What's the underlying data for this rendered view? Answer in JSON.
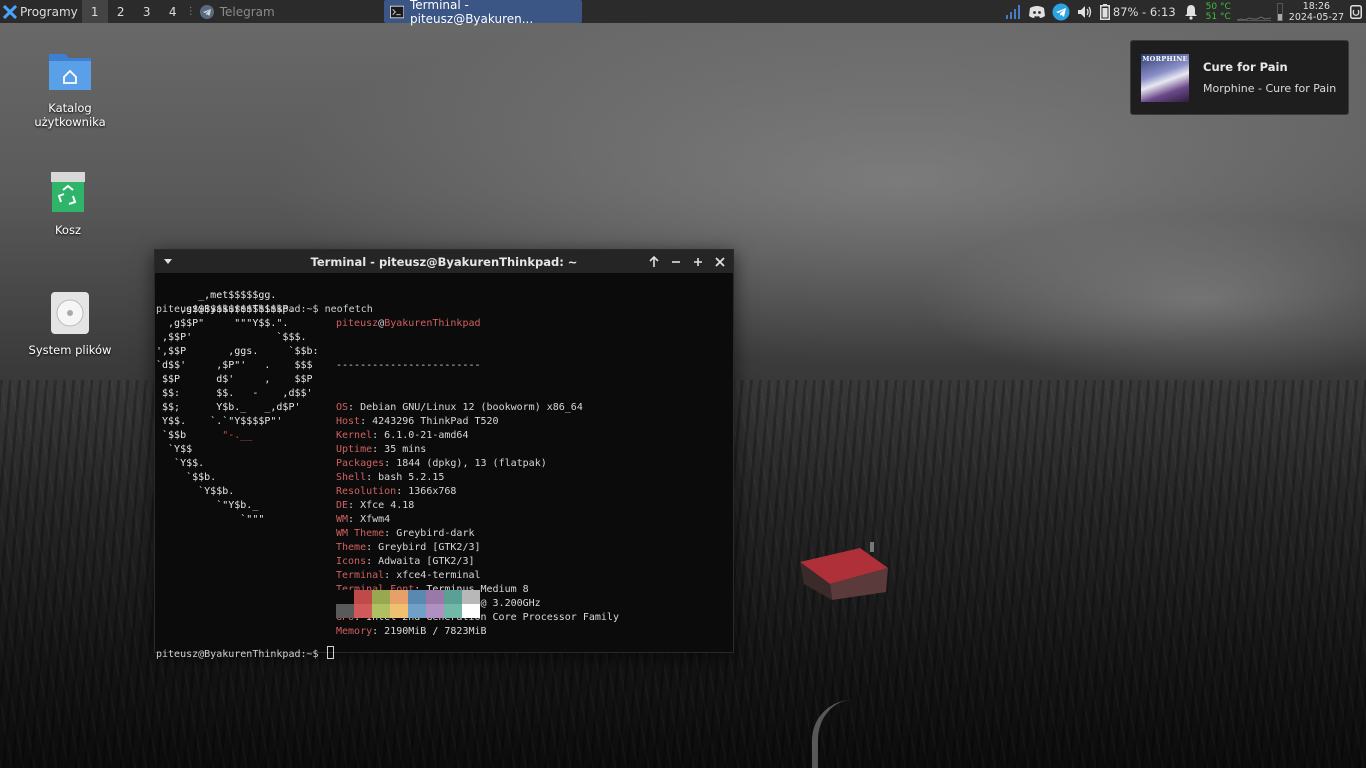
{
  "panel": {
    "menu_label": "Programy",
    "workspaces": [
      "1",
      "2",
      "3",
      "4"
    ],
    "tasks": [
      {
        "label": "Telegram",
        "active": false
      },
      {
        "label": "Terminal - piteusz@Byakuren...",
        "active": true
      }
    ],
    "battery_text": "87% - 6:13",
    "temp_1": "50 °C",
    "temp_2": "51 °C",
    "clock_time": "18:26",
    "clock_date": "2024-05-27"
  },
  "desktop": {
    "icons": [
      {
        "label": "Katalog użytkownika",
        "icon": "home-folder-icon"
      },
      {
        "label": "Kosz",
        "icon": "trash-icon"
      },
      {
        "label": "System plików",
        "icon": "drive-icon"
      }
    ]
  },
  "notification": {
    "album_text": "MORPHINE",
    "title": "Cure for Pain",
    "body": "Morphine - Cure for Pain"
  },
  "terminal": {
    "title": "Terminal - piteusz@ByakurenThinkpad: ~",
    "prompt": "piteusz@ByakurenThinkpad:~$",
    "command": "neofetch",
    "user": "piteusz",
    "at": "@",
    "host": "ByakurenThinkpad",
    "dashes": "------------------------",
    "info": [
      {
        "key": "OS",
        "value": "Debian GNU/Linux 12 (bookworm) x86_64"
      },
      {
        "key": "Host",
        "value": "4243296 ThinkPad T520"
      },
      {
        "key": "Kernel",
        "value": "6.1.0-21-amd64"
      },
      {
        "key": "Uptime",
        "value": "35 mins"
      },
      {
        "key": "Packages",
        "value": "1844 (dpkg), 13 (flatpak)"
      },
      {
        "key": "Shell",
        "value": "bash 5.2.15"
      },
      {
        "key": "Resolution",
        "value": "1366x768"
      },
      {
        "key": "DE",
        "value": "Xfce 4.18"
      },
      {
        "key": "WM",
        "value": "Xfwm4"
      },
      {
        "key": "WM Theme",
        "value": "Greybird-dark"
      },
      {
        "key": "Theme",
        "value": "Greybird [GTK2/3]"
      },
      {
        "key": "Icons",
        "value": "Adwaita [GTK2/3]"
      },
      {
        "key": "Terminal",
        "value": "xfce4-terminal"
      },
      {
        "key": "Terminal Font",
        "value": "Terminus Medium 8"
      },
      {
        "key": "CPU",
        "value": "Intel i5-2520M (4) @ 3.200GHz"
      },
      {
        "key": "GPU",
        "value": "Intel 2nd Generation Core Processor Family"
      },
      {
        "key": "Memory",
        "value": "2190MiB / 7823MiB"
      }
    ],
    "palette_top": [
      "#0b0b0b",
      "#c04a4a",
      "#98a850",
      "#e8a06a",
      "#5a88b0",
      "#9a78a8",
      "#5aa094",
      "#b8b8b8"
    ],
    "palette_bottom": [
      "#5a5a5a",
      "#d05a5a",
      "#b0c060",
      "#f0c070",
      "#70a0c8",
      "#b090c0",
      "#70b8a8",
      "#ffffff"
    ]
  }
}
